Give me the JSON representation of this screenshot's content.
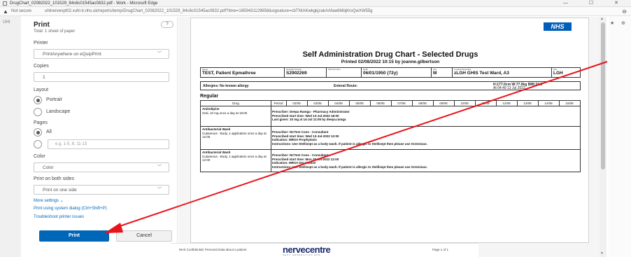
{
  "browser": {
    "tab_title": "DrugChart_02082022_101529_84c6c01545ac0832.pdf - Work - Microsoft Edge",
    "window_controls": "— ☐ ✕",
    "security_label": "Not secure",
    "url": "uhlnervenpt02.xuhl-tr.nhs.uk/reports/temp/DrugChart_02082022_101529_84c6c01545ac0832.pdf?time=1659431129658&signature=cbTNIAKwkgkjzakAAfaw6MbjKtsQwXW55g",
    "left_strip_text": "UHI",
    "right_icons": [
      "★",
      "⊕"
    ]
  },
  "print_dialog": {
    "title": "Print",
    "subtitle": "Total: 1 sheet of paper",
    "help_label": "?",
    "printer_label": "Printer",
    "printer_value": "PrintAnywhere on eQuipPrint",
    "copies_label": "Copies",
    "copies_value": "1",
    "layout_label": "Layout",
    "layout_portrait": "Portrait",
    "layout_landscape": "Landscape",
    "pages_label": "Pages",
    "pages_all": "All",
    "pages_placeholder": "e.g. 1-5, 8, 11-13",
    "color_label": "Color",
    "color_value": "Color",
    "both_sides_label": "Print on both sides",
    "both_sides_value": "Print on one side",
    "more_settings": "More settings ⌄",
    "system_dialog_link": "Print using system dialog (Ctrl+Shift+P)",
    "troubleshoot_link": "Troubleshoot printer issues",
    "print_button": "Print",
    "cancel_button": "Cancel"
  },
  "document": {
    "logo": "NHS",
    "title": "Self Administration Drug Chart - Selected Drugs",
    "printed": "Printed 02/08/2022 10:15 by joanne.gilbertson",
    "patient": {
      "name_label": "Name",
      "name": "TEST, Patient Epmathree",
      "hosp_label": "Hospital Number",
      "hosp": "S2902269",
      "nhs_label": "NHS Number",
      "nhs": "",
      "dob_label": "DOB",
      "dob": "06/01/1950 (72y)",
      "sex_label": "Sex",
      "sex": "M",
      "loc_label": "Location/Specialty",
      "loc": "zLGH GHIS Test Ward, A3",
      "site_label": "Site",
      "site": "LGH"
    },
    "allergies": "Allergies: No known allergy",
    "enteral": "Enteral Route:",
    "measures": "H:177.0cm W:77.0kg BMI:24.6",
    "measures_date": "At 04:49 13 Jul 2022",
    "section": "Regular",
    "drug_col": "Drug",
    "period_col": "Period",
    "dates": [
      "02/08",
      "03/08",
      "04/08",
      "05/08",
      "06/08",
      "07/08",
      "08/08",
      "09/08",
      "10/08",
      "11/08",
      "12/08",
      "13/08",
      "14/08",
      "15/08"
    ],
    "drugs": [
      {
        "name": "Amlodipine",
        "detail": "Oral, 10 mg once a day at 18:00",
        "line1": "Prescriber: Deepa Ramga - Pharmacy Administrator",
        "line2": "Prescribed start time: Wed 13-Jul-2022 18:00",
        "line3": "Last given: 10 mg at 14-Jul 11:05 by deepa.ramga"
      },
      {
        "name": "Antibacterial Wash",
        "detail": "Cutaneous - Body, 1 application once a day at 12:00",
        "line1": "Prescriber: NCTest Cons - Consultant",
        "line2": "Prescribed start time: Wed 13-Jul-2022 12:00",
        "line3": "Indication: MRSA Prophylaxis",
        "line4": "Instructions: Use Stellisept as a body wash. If patient is allergic to Stellisept then please use Octenisan."
      },
      {
        "name": "Antibacterial Wash",
        "detail": "Cutaneous - Body, 1 application once a day at 12:00",
        "line1": "Prescriber: NCTest Cons - Consultant",
        "line2": "Prescribed start time: Mon 25-Jul-2022 12:00",
        "line3": "Indication: MRSA Decolonise",
        "line4": "Instructions: Use Stellisept as a body wash. If patient is allergic to Stellisept then please use Octenisan."
      }
    ],
    "footer_left": "NHS Confidential: Personal Data about a patient",
    "footer_logo": "nervecentre",
    "footer_logo_sub": "NEXT GENERATION EPR",
    "footer_page": "Page 1 of 1"
  },
  "annotation": {
    "arrow_color": "#e8141c"
  }
}
